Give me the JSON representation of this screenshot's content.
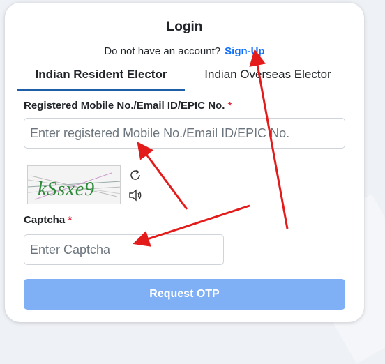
{
  "login": {
    "title": "Login",
    "no_account_text": "Do not have an account?",
    "signup_label": "Sign-Up"
  },
  "tabs": [
    {
      "label": "Indian Resident Elector",
      "active": true
    },
    {
      "label": "Indian Overseas Elector",
      "active": false
    }
  ],
  "mobile_field": {
    "label": "Registered Mobile No./Email ID/EPIC No.",
    "required_mark": "*",
    "placeholder": "Enter registered Mobile No./Email ID/EPIC No.",
    "value": ""
  },
  "captcha": {
    "image_text": "kSsxe9",
    "refresh_icon": "refresh-icon",
    "audio_icon": "speaker-icon",
    "label": "Captcha",
    "required_mark": "*",
    "placeholder": "Enter Captcha",
    "value": ""
  },
  "submit": {
    "label": "Request OTP"
  },
  "colors": {
    "link": "#0d6efd",
    "button": "#7fb0f5",
    "required": "#dc3545",
    "tab_underline": "#1f5fa8",
    "arrow": "#e31b1b",
    "captcha_text": "#2e8b3a"
  }
}
